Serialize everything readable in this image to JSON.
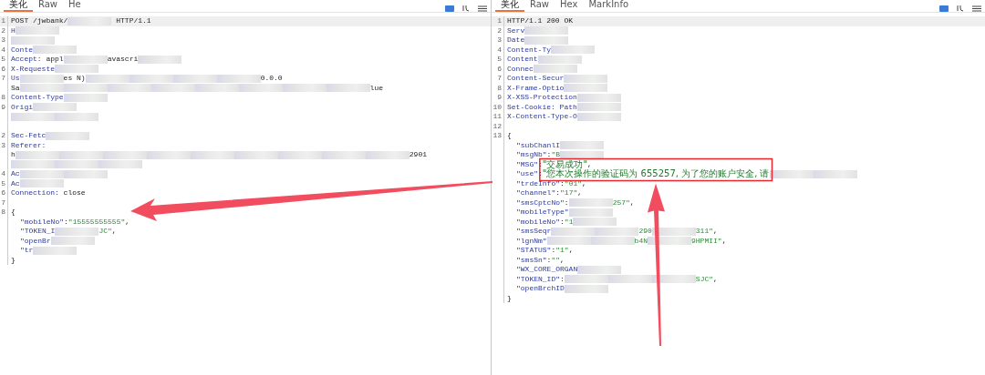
{
  "panes": [
    {
      "tabs": [
        {
          "label": "美化",
          "selected": true
        },
        {
          "label": "Raw",
          "selected": false
        },
        {
          "label": "He",
          "selected": false
        }
      ],
      "lines": [
        {
          "number": "1",
          "highlighted": true,
          "parts": [
            {
              "kind": "plain",
              "text": "POST /jwbank/"
            },
            {
              "kind": "redacted"
            },
            {
              "kind": "plain",
              "text": " HTTP/1.1"
            }
          ]
        },
        {
          "number": "2",
          "highlighted": false,
          "parts": [
            {
              "kind": "name",
              "text": "H"
            },
            {
              "kind": "redacted"
            }
          ]
        },
        {
          "number": "3",
          "highlighted": false,
          "parts": [
            {
              "kind": "redacted"
            }
          ]
        },
        {
          "number": "4",
          "highlighted": false,
          "parts": [
            {
              "kind": "name",
              "text": "Conte"
            },
            {
              "kind": "redacted"
            }
          ]
        },
        {
          "number": "5",
          "highlighted": false,
          "parts": [
            {
              "kind": "name",
              "text": "Accept:"
            },
            {
              "kind": "plain",
              "text": " appl"
            },
            {
              "kind": "redacted"
            },
            {
              "kind": "plain",
              "text": "avascri"
            },
            {
              "kind": "redacted"
            }
          ]
        },
        {
          "number": "6",
          "highlighted": false,
          "parts": [
            {
              "kind": "name",
              "text": "X-Requeste"
            },
            {
              "kind": "redacted"
            }
          ]
        },
        {
          "number": "7",
          "highlighted": false,
          "parts": [
            {
              "kind": "name",
              "text": "Us"
            },
            {
              "kind": "redacted"
            },
            {
              "kind": "plain",
              "text": "es N)"
            },
            {
              "kind": "redacted"
            },
            {
              "kind": "redacted"
            },
            {
              "kind": "redacted"
            },
            {
              "kind": "redacted"
            },
            {
              "kind": "plain",
              "text": "0.0.0"
            }
          ]
        },
        {
          "highlighted": false,
          "parts": [
            {
              "kind": "plain",
              "text": "Sa"
            },
            {
              "kind": "redacted"
            },
            {
              "kind": "redacted"
            },
            {
              "kind": "redacted"
            },
            {
              "kind": "redacted"
            },
            {
              "kind": "redacted"
            },
            {
              "kind": "redacted"
            },
            {
              "kind": "redacted"
            },
            {
              "kind": "redacted"
            },
            {
              "kind": "plain",
              "text": "lue"
            }
          ]
        },
        {
          "number": "8",
          "highlighted": false,
          "parts": [
            {
              "kind": "name",
              "text": "Content-Type"
            },
            {
              "kind": "redacted"
            }
          ]
        },
        {
          "number": "9",
          "highlighted": false,
          "parts": [
            {
              "kind": "name",
              "text": "Origi"
            },
            {
              "kind": "redacted"
            }
          ]
        },
        {
          "highlighted": false,
          "parts": [
            {
              "kind": "redacted"
            },
            {
              "kind": "redacted"
            }
          ]
        },
        {
          "highlighted": false
        },
        {
          "number": "2",
          "highlighted": false,
          "parts": [
            {
              "kind": "name",
              "text": "Sec-Fetc"
            },
            {
              "kind": "redacted"
            }
          ]
        },
        {
          "number": "3",
          "highlighted": false,
          "parts": [
            {
              "kind": "name",
              "text": "Referer:"
            }
          ]
        },
        {
          "highlighted": false,
          "parts": [
            {
              "kind": "plain",
              "text": "h"
            },
            {
              "kind": "redacted"
            },
            {
              "kind": "redacted"
            },
            {
              "kind": "redacted"
            },
            {
              "kind": "redacted"
            },
            {
              "kind": "redacted"
            },
            {
              "kind": "redacted"
            },
            {
              "kind": "redacted"
            },
            {
              "kind": "redacted"
            },
            {
              "kind": "redacted"
            },
            {
              "kind": "plain",
              "text": "2901"
            }
          ]
        },
        {
          "highlighted": false,
          "parts": [
            {
              "kind": "redacted"
            },
            {
              "kind": "redacted"
            },
            {
              "kind": "redacted"
            }
          ]
        },
        {
          "number": "4",
          "highlighted": false,
          "parts": [
            {
              "kind": "name",
              "text": "Ac"
            },
            {
              "kind": "redacted"
            },
            {
              "kind": "redacted"
            }
          ]
        },
        {
          "number": "5",
          "highlighted": false,
          "parts": [
            {
              "kind": "name",
              "text": "Ac"
            },
            {
              "kind": "redacted"
            }
          ]
        },
        {
          "number": "6",
          "highlighted": false,
          "parts": [
            {
              "kind": "name",
              "text": "Connection:"
            },
            {
              "kind": "plain",
              "text": " close"
            }
          ]
        },
        {
          "number": "7",
          "highlighted": false
        },
        {
          "number": "8",
          "highlighted": false,
          "parts": [
            {
              "kind": "plain",
              "text": "{"
            }
          ],
          "children": [
            {
              "highlighted": false,
              "parts": [
                {
                  "kind": "name",
                  "text": "\"mobileNo\""
                },
                {
                  "kind": "plain",
                  "text": ":"
                },
                {
                  "kind": "string",
                  "text": "\"15555555555\""
                },
                {
                  "kind": "plain",
                  "text": ","
                }
              ]
            },
            {
              "highlighted": false,
              "parts": [
                {
                  "kind": "name",
                  "text": "\"TOKEN_I"
                },
                {
                  "kind": "redacted"
                },
                {
                  "kind": "string",
                  "text": "JC\""
                },
                {
                  "kind": "plain",
                  "text": ","
                }
              ]
            },
            {
              "highlighted": false,
              "parts": [
                {
                  "kind": "name",
                  "text": "\"openBr"
                },
                {
                  "kind": "redacted"
                }
              ]
            },
            {
              "highlighted": false,
              "parts": [
                {
                  "kind": "name",
                  "text": "\"tr"
                },
                {
                  "kind": "redacted"
                }
              ]
            }
          ]
        },
        {
          "highlighted": false,
          "parts": [
            {
              "kind": "plain",
              "text": "}"
            }
          ]
        }
      ]
    },
    {
      "tabs": [
        {
          "label": "美化",
          "selected": true
        },
        {
          "label": "Raw",
          "selected": false
        },
        {
          "label": "Hex",
          "selected": false
        },
        {
          "label": "MarkInfo",
          "selected": false
        }
      ],
      "lines": [
        {
          "number": "1",
          "highlighted": true,
          "parts": [
            {
              "kind": "plain",
              "text": "HTTP/1.1 200 OK"
            }
          ]
        },
        {
          "number": "2",
          "highlighted": false,
          "parts": [
            {
              "kind": "name",
              "text": "Serv"
            },
            {
              "kind": "redacted"
            }
          ]
        },
        {
          "number": "3",
          "highlighted": false,
          "parts": [
            {
              "kind": "name",
              "text": "Date"
            },
            {
              "kind": "redacted"
            }
          ]
        },
        {
          "number": "4",
          "highlighted": false,
          "parts": [
            {
              "kind": "name",
              "text": "Content-Ty"
            },
            {
              "kind": "redacted"
            }
          ]
        },
        {
          "number": "5",
          "highlighted": false,
          "parts": [
            {
              "kind": "name",
              "text": "Content"
            },
            {
              "kind": "redacted"
            }
          ]
        },
        {
          "number": "6",
          "highlighted": false,
          "parts": [
            {
              "kind": "name",
              "text": "Connec"
            },
            {
              "kind": "redacted"
            }
          ]
        },
        {
          "number": "7",
          "highlighted": false,
          "parts": [
            {
              "kind": "name",
              "text": "Content-Secur"
            },
            {
              "kind": "redacted"
            }
          ]
        },
        {
          "number": "8",
          "highlighted": false,
          "parts": [
            {
              "kind": "name",
              "text": "X-Frame-Optio"
            },
            {
              "kind": "redacted"
            }
          ]
        },
        {
          "number": "9",
          "highlighted": false,
          "parts": [
            {
              "kind": "name",
              "text": "X-XSS-Protection"
            },
            {
              "kind": "redacted"
            }
          ]
        },
        {
          "number": "10",
          "highlighted": false,
          "parts": [
            {
              "kind": "name",
              "text": "Set-Cookie: Path"
            },
            {
              "kind": "redacted"
            }
          ]
        },
        {
          "number": "11",
          "highlighted": false,
          "parts": [
            {
              "kind": "name",
              "text": "X-Content-Type-O"
            },
            {
              "kind": "redacted"
            }
          ]
        },
        {
          "number": "12",
          "highlighted": false
        },
        {
          "number": "13",
          "highlighted": false,
          "parts": [
            {
              "kind": "plain",
              "text": "{"
            }
          ],
          "children": [
            {
              "highlighted": false,
              "parts": [
                {
                  "kind": "name",
                  "text": "\"subChanlI"
                },
                {
                  "kind": "redacted"
                }
              ]
            },
            {
              "highlighted": false,
              "parts": [
                {
                  "kind": "name",
                  "text": "\"msgNb\""
                },
                {
                  "kind": "plain",
                  "text": ":"
                },
                {
                  "kind": "string",
                  "text": "\"B"
                },
                {
                  "kind": "redacted"
                }
              ]
            },
            {
              "highlighted": false,
              "parts": [
                {
                  "kind": "name",
                  "text": "\"MSG\""
                },
                {
                  "kind": "plain",
                  "text": ":"
                },
                {
                  "kind": "cjk-string",
                  "text": "\"交易成功\""
                },
                {
                  "kind": "plain",
                  "text": ","
                }
              ]
            },
            {
              "highlighted": false,
              "parts": [
                {
                  "kind": "name",
                  "text": "\"use\""
                },
                {
                  "kind": "plain",
                  "text": ":"
                },
                {
                  "kind": "cjk-string",
                  "text": "\"您本次操作的验证码为 655257, 为了您的账户安全, 请"
                },
                {
                  "kind": "redacted"
                },
                {
                  "kind": "redacted"
                }
              ]
            },
            {
              "highlighted": false,
              "parts": [
                {
                  "kind": "name",
                  "text": "\"trdeInfo\""
                },
                {
                  "kind": "plain",
                  "text": ":"
                },
                {
                  "kind": "string",
                  "text": "\"01\""
                },
                {
                  "kind": "plain",
                  "text": ","
                }
              ]
            },
            {
              "highlighted": false,
              "parts": [
                {
                  "kind": "name",
                  "text": "\"channel\""
                },
                {
                  "kind": "plain",
                  "text": ":"
                },
                {
                  "kind": "string",
                  "text": "\"17\""
                },
                {
                  "kind": "plain",
                  "text": ","
                }
              ]
            },
            {
              "highlighted": false,
              "parts": [
                {
                  "kind": "name",
                  "text": "\"smsCptcNo\""
                },
                {
                  "kind": "plain",
                  "text": ":"
                },
                {
                  "kind": "redacted"
                },
                {
                  "kind": "string",
                  "text": "257\""
                },
                {
                  "kind": "plain",
                  "text": ","
                }
              ]
            },
            {
              "highlighted": false,
              "parts": [
                {
                  "kind": "name",
                  "text": "\"mobileType\""
                },
                {
                  "kind": "redacted"
                }
              ]
            },
            {
              "highlighted": false,
              "parts": [
                {
                  "kind": "name",
                  "text": "\"mobileNo\""
                },
                {
                  "kind": "plain",
                  "text": ":"
                },
                {
                  "kind": "string",
                  "text": "\"1"
                },
                {
                  "kind": "redacted"
                }
              ]
            },
            {
              "highlighted": false,
              "parts": [
                {
                  "kind": "name",
                  "text": "\"smsSeqr"
                },
                {
                  "kind": "redacted"
                },
                {
                  "kind": "redacted"
                },
                {
                  "kind": "string",
                  "text": "290"
                },
                {
                  "kind": "redacted"
                },
                {
                  "kind": "string",
                  "text": "311\""
                },
                {
                  "kind": "plain",
                  "text": ","
                }
              ]
            },
            {
              "highlighted": false,
              "parts": [
                {
                  "kind": "name",
                  "text": "\"lgnNm\""
                },
                {
                  "kind": "redacted"
                },
                {
                  "kind": "redacted"
                },
                {
                  "kind": "string",
                  "text": "b4N"
                },
                {
                  "kind": "redacted"
                },
                {
                  "kind": "string",
                  "text": "9HPMII\""
                },
                {
                  "kind": "plain",
                  "text": ","
                }
              ]
            },
            {
              "highlighted": false,
              "parts": [
                {
                  "kind": "name",
                  "text": "\"STATUS\""
                },
                {
                  "kind": "plain",
                  "text": ":"
                },
                {
                  "kind": "string",
                  "text": "\"1\""
                },
                {
                  "kind": "plain",
                  "text": ","
                }
              ]
            },
            {
              "highlighted": false,
              "parts": [
                {
                  "kind": "name",
                  "text": "\"smsSn\""
                },
                {
                  "kind": "plain",
                  "text": ":"
                },
                {
                  "kind": "string",
                  "text": "\"\""
                },
                {
                  "kind": "plain",
                  "text": ","
                }
              ]
            },
            {
              "highlighted": false,
              "parts": [
                {
                  "kind": "name",
                  "text": "\"WX_CORE_ORGAN"
                },
                {
                  "kind": "redacted"
                }
              ]
            },
            {
              "highlighted": false,
              "parts": [
                {
                  "kind": "name",
                  "text": "\"TOKEN_ID\""
                },
                {
                  "kind": "plain",
                  "text": ":"
                },
                {
                  "kind": "redacted"
                },
                {
                  "kind": "redacted"
                },
                {
                  "kind": "redacted"
                },
                {
                  "kind": "string",
                  "text": "SJC\""
                },
                {
                  "kind": "plain",
                  "text": ","
                }
              ]
            },
            {
              "highlighted": false,
              "parts": [
                {
                  "kind": "name",
                  "text": "\"openBrchID"
                },
                {
                  "kind": "redacted"
                }
              ]
            }
          ]
        },
        {
          "highlighted": false,
          "parts": [
            {
              "kind": "plain",
              "text": "}"
            }
          ]
        }
      ]
    }
  ],
  "annotations": [
    {
      "kind": "arrow"
    },
    {
      "kind": "arrow"
    },
    {
      "kind": "box"
    }
  ]
}
